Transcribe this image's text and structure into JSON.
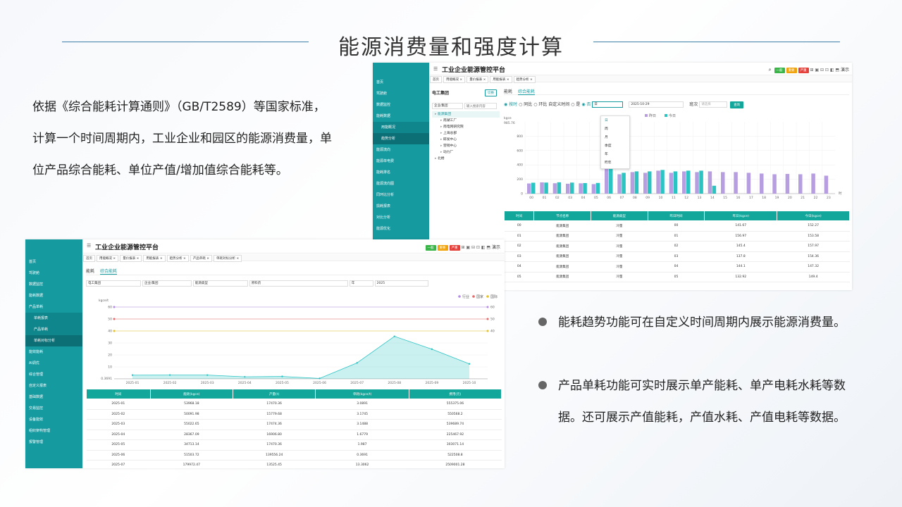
{
  "slide": {
    "title": "能源消费量和强度计算",
    "intro": "依据《综合能耗计算通则》（GB/T2589）等国家标准，计算一个时间周期内，工业企业和园区的能源消费量，单位产品综合能耗、单位产值/增加值综合能耗等。",
    "bullets": [
      "能耗趋势功能可在自定义时间周期内展示能源消费量。",
      "产品单耗功能可实时展示单产能耗、单产电耗水耗等数据。还可展示产值能耗，产值水耗、产值电耗等数据。"
    ]
  },
  "colors": {
    "accent": "#159aa0",
    "table_header": "#13a69a",
    "bar_purple": "#b79ee0",
    "bar_teal": "#2cc3c3"
  },
  "win1": {
    "app_title": "工业企业能源管控平台",
    "badges": [
      {
        "text": "一般",
        "color": "#3bb54a"
      },
      {
        "text": "重要",
        "color": "#f0a30a"
      },
      {
        "text": "严重",
        "color": "#e5413b"
      }
    ],
    "header_extra": "演示",
    "tabs": [
      "首页",
      "用能概况 ×",
      "量价报表 ×",
      "用能报表 ×",
      "趋势分析 ×"
    ],
    "sidebar": [
      "首页",
      "驾驶舱",
      "数据监控",
      "能耗数据",
      "用能概况",
      "趋势分析",
      "能源流向",
      "能源单电费",
      "能耗排名",
      "能源流向图",
      "同环比分析",
      "损耗报表",
      "对比分析",
      "能源优化"
    ],
    "tree_title": "电工集团",
    "tree_button": "切换",
    "tree_select": "企业/集团",
    "tree_search_placeholder": "输入搜索内容",
    "tree_items": [
      "能源集团",
      "南湖工厂",
      "南电网研究院",
      "上海总部",
      "研发中心",
      "营销中心",
      "动力厂",
      "北楼"
    ],
    "subtabs": [
      "能耗",
      "综合能耗"
    ],
    "filters": {
      "opt1": "按时",
      "opt2": "同比",
      "opt3": "环比",
      "opt4": "自定义时间",
      "yes": "是",
      "no": "否",
      "period": "日",
      "date": "2025-10-29",
      "shift_label": "班次",
      "shift_placeholder": "请选择",
      "query": "查询"
    },
    "dropdown": [
      "日",
      "周",
      "月",
      "季度",
      "年",
      "昨年"
    ],
    "legend": [
      "昨日",
      "今日"
    ],
    "ylabel": "kgce",
    "table_headers": [
      "时间",
      "节点名称",
      "能源类型",
      "昨日时间",
      "昨日(kgce)",
      "今日(kgce)"
    ],
    "table_rows": [
      [
        "00",
        "能源集团",
        "冷量",
        "00",
        "141.67",
        "152.27"
      ],
      [
        "01",
        "能源集团",
        "冷量",
        "01",
        "156.97",
        "153.58"
      ],
      [
        "02",
        "能源集团",
        "冷量",
        "02",
        "145.4",
        "157.97"
      ],
      [
        "03",
        "能源集团",
        "冷量",
        "03",
        "137.8",
        "154.36"
      ],
      [
        "04",
        "能源集团",
        "冷量",
        "04",
        "144.1",
        "147.32"
      ],
      [
        "05",
        "能源集团",
        "冷量",
        "05",
        "132.92",
        "149.4"
      ]
    ]
  },
  "win2": {
    "app_title": "工业企业能源管控平台",
    "header_extra": "演示",
    "tabs": [
      "首页",
      "用能概况 ×",
      "量价报表 ×",
      "用能报表 ×",
      "趋势分析 ×",
      "产品单耗 ×",
      "单耗对标分析 ×"
    ],
    "sidebar": [
      "首页",
      "驾驶舱",
      "数据监控",
      "能耗数据",
      "产品单耗",
      "单耗报表",
      "产品单耗",
      "单耗对标分析",
      "能效能耗",
      "AI调优",
      "综合管理",
      "自定义报表",
      "基础数据",
      "交易监控",
      "设备能效",
      "组织架构管理",
      "报警管理"
    ],
    "subtabs": [
      "能耗",
      "综合能耗"
    ],
    "filters": [
      "电工集团",
      "企业/集团",
      "能源类型",
      "原料药",
      "年",
      "2025"
    ],
    "legend": [
      "行业",
      "国家",
      "国际"
    ],
    "ylabel": "kgce/t",
    "table_headers": [
      "时间",
      "能耗(kgce)",
      "产量(t)",
      "单耗(kgce/t)",
      "费用(元)"
    ],
    "table_rows": [
      [
        "2025-01",
        "53968.18",
        "17470.36",
        "3.0891",
        "555375.06"
      ],
      [
        "2025-02",
        "50091.98",
        "15779.68",
        "3.1745",
        "550568.2"
      ],
      [
        "2025-03",
        "55022.65",
        "17474.36",
        "3.1488",
        "539689.74"
      ],
      [
        "2025-04",
        "28367.09",
        "16906.80",
        "1.6779",
        "225467.92"
      ],
      [
        "2025-05",
        "34713.14",
        "17470.36",
        "1.987",
        "303071.14"
      ],
      [
        "2025-06",
        "51503.72",
        "139556.24",
        "0.3691",
        "522508.8"
      ],
      [
        "2025-07",
        "179972.47",
        "13525.45",
        "13.3062",
        "2509001.28"
      ]
    ]
  },
  "chart_data": [
    {
      "type": "bar",
      "title": "",
      "ylabel": "kgce",
      "categories": [
        "00",
        "01",
        "02",
        "03",
        "04",
        "05",
        "06",
        "07",
        "08",
        "09",
        "10",
        "11",
        "12",
        "13",
        "14",
        "15",
        "16",
        "17",
        "18",
        "19",
        "20",
        "21",
        "22",
        "23"
      ],
      "series": [
        {
          "name": "昨日",
          "values": [
            142,
            157,
            145,
            138,
            144,
            133,
            360,
            270,
            300,
            290,
            320,
            290,
            310,
            300,
            310,
            300,
            300,
            290,
            280,
            270,
            275,
            270,
            280,
            250
          ]
        },
        {
          "name": "今日",
          "values": [
            152,
            154,
            158,
            154,
            147,
            149,
            985,
            290,
            310,
            310,
            330,
            310,
            320,
            320,
            110,
            null,
            null,
            null,
            null,
            null,
            null,
            null,
            null,
            null
          ]
        }
      ],
      "ylim": [
        0,
        1000
      ],
      "yticks": [
        0,
        200,
        400,
        600,
        800
      ],
      "ymax_label": "985.76",
      "x_unit": "时"
    },
    {
      "type": "area",
      "title": "",
      "ylabel": "kgce/t",
      "x": [
        "2025-01",
        "2025-02",
        "2025-03",
        "2025-04",
        "2025-05",
        "2025-06",
        "2025-07",
        "2025-08",
        "2025-09",
        "2025-10"
      ],
      "series": [
        {
          "name": "单耗",
          "values": [
            3.09,
            3.17,
            3.15,
            1.68,
            1.99,
            0.37,
            13.31,
            35.5,
            24.8,
            12.5
          ]
        }
      ],
      "reference_lines": [
        {
          "name": "行业",
          "value": 60,
          "color": "#b48ee6"
        },
        {
          "name": "国家",
          "value": 50,
          "color": "#e66a6a"
        },
        {
          "name": "国际",
          "value": 40,
          "color": "#e6c229"
        }
      ],
      "ylim": [
        0,
        60
      ],
      "yticks": [
        0.3691,
        10,
        20,
        30,
        40,
        50,
        60
      ]
    }
  ]
}
